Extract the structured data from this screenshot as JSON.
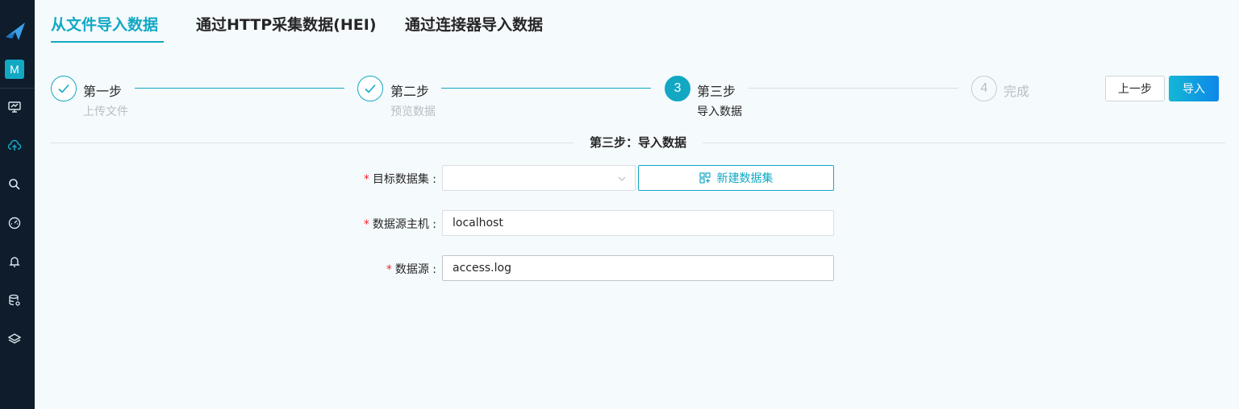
{
  "sidebar": {
    "avatar_letter": "M",
    "nav_icons": [
      "dashboard-icon",
      "cloud-upload-icon",
      "search-icon",
      "gauge-icon",
      "bell-icon",
      "database-settings-icon",
      "layers-icon"
    ]
  },
  "tabs": [
    {
      "label": "从文件导入数据",
      "active": true
    },
    {
      "label": "通过HTTP采集数据(HEI)",
      "active": false
    },
    {
      "label": "通过连接器导入数据",
      "active": false
    }
  ],
  "steps": [
    {
      "number": "1",
      "title": "第一步",
      "desc": "上传文件",
      "status": "done"
    },
    {
      "number": "2",
      "title": "第二步",
      "desc": "预览数据",
      "status": "done"
    },
    {
      "number": "3",
      "title": "第三步",
      "desc": "导入数据",
      "status": "current"
    },
    {
      "number": "4",
      "title": "完成",
      "desc": "",
      "status": "wait"
    }
  ],
  "buttons": {
    "prev": "上一步",
    "import": "导入"
  },
  "section_title": "第三步：导入数据",
  "form": {
    "target_dataset": {
      "label": "目标数据集 :",
      "value": "",
      "new_button": "新建数据集"
    },
    "source_host": {
      "label": "数据源主机 :",
      "value": "localhost"
    },
    "source": {
      "label": "数据源 :",
      "value": "access.log"
    }
  },
  "colors": {
    "accent": "#12a8c4",
    "sidebar_bg": "#0e1c2c",
    "required": "#f5222d"
  }
}
